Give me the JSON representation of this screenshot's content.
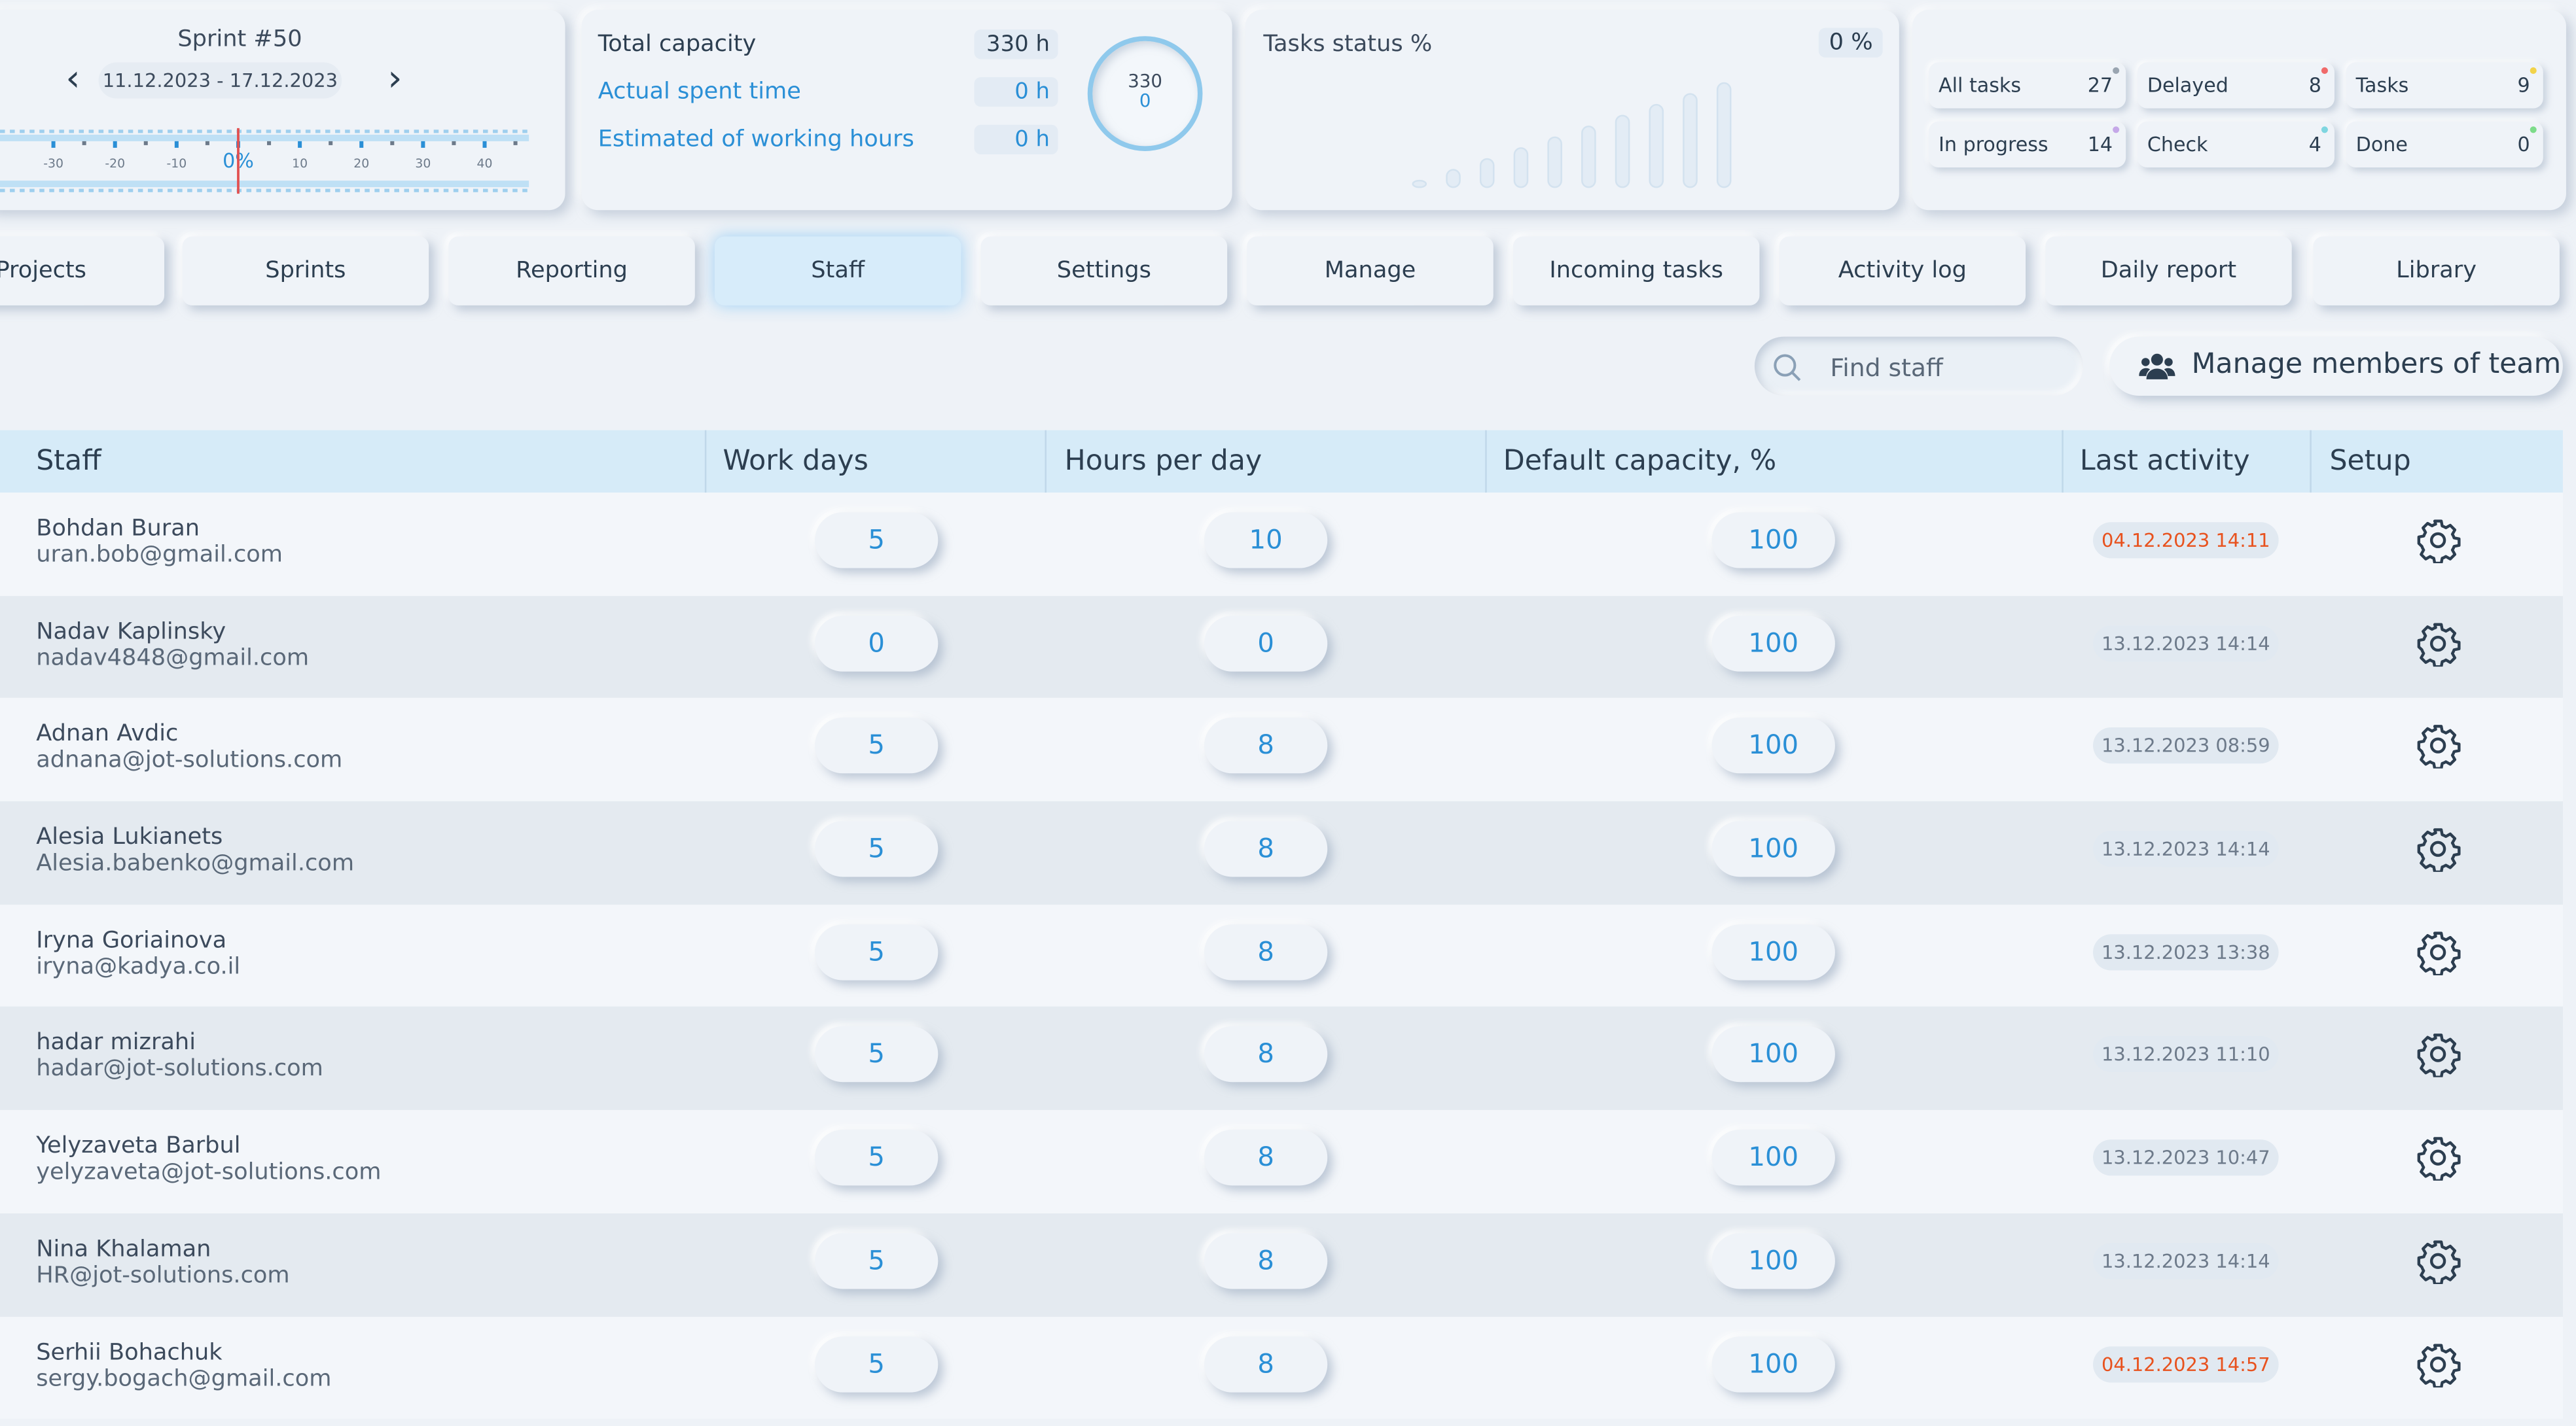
{
  "sprint": {
    "title": "Sprint #50",
    "range": "11.12.2023 - 17.12.2023",
    "scale_ticks": [
      "-30",
      "-20",
      "-10",
      "0%",
      "10",
      "20",
      "30",
      "40"
    ]
  },
  "capacity": {
    "total_label": "Total capacity",
    "total_value": "330 h",
    "actual_label": "Actual spent time",
    "actual_value": "0 h",
    "estimated_label": "Estimated of working hours",
    "estimated_value": "0 h",
    "ring_top": "330",
    "ring_bottom": "0"
  },
  "status": {
    "title": "Tasks status %",
    "value": "0 %"
  },
  "counts": [
    {
      "label": "All tasks",
      "value": "27",
      "dot": "#9aa5b1"
    },
    {
      "label": "Delayed",
      "value": "8",
      "dot": "#f06a6a"
    },
    {
      "label": "Tasks",
      "value": "9",
      "dot": "#f2d34a"
    },
    {
      "label": "In progress",
      "value": "14",
      "dot": "#c5a8e8"
    },
    {
      "label": "Check",
      "value": "4",
      "dot": "#7fd6e0"
    },
    {
      "label": "Done",
      "value": "0",
      "dot": "#7ddc8a"
    }
  ],
  "tabs": [
    "Projects",
    "Sprints",
    "Reporting",
    "Staff",
    "Settings",
    "Manage",
    "Incoming tasks",
    "Activity log",
    "Daily report",
    "Library"
  ],
  "active_tab": "Staff",
  "search": {
    "placeholder": "Find staff"
  },
  "manage_button": "Manage members of team",
  "table": {
    "headers": {
      "staff": "Staff",
      "work_days": "Work days",
      "hours": "Hours per day",
      "capacity": "Default capacity, %",
      "activity": "Last activity",
      "setup": "Setup"
    },
    "rows": [
      {
        "name": "Bohdan Buran",
        "email": "uran.bob@gmail.com",
        "work_days": "5",
        "hours": "10",
        "capacity": "100",
        "activity": "04.12.2023 14:11",
        "stale": true
      },
      {
        "name": "Nadav Kaplinsky",
        "email": "nadav4848@gmail.com",
        "work_days": "0",
        "hours": "0",
        "capacity": "100",
        "activity": "13.12.2023 14:14",
        "stale": false
      },
      {
        "name": "Adnan Avdic",
        "email": "adnana@jot-solutions.com",
        "work_days": "5",
        "hours": "8",
        "capacity": "100",
        "activity": "13.12.2023 08:59",
        "stale": false
      },
      {
        "name": "Alesia Lukianets",
        "email": "Alesia.babenko@gmail.com",
        "work_days": "5",
        "hours": "8",
        "capacity": "100",
        "activity": "13.12.2023 14:14",
        "stale": false
      },
      {
        "name": "Iryna Goriainova",
        "email": "iryna@kadya.co.il",
        "work_days": "5",
        "hours": "8",
        "capacity": "100",
        "activity": "13.12.2023 13:38",
        "stale": false
      },
      {
        "name": "hadar mizrahi",
        "email": "hadar@jot-solutions.com",
        "work_days": "5",
        "hours": "8",
        "capacity": "100",
        "activity": "13.12.2023 11:10",
        "stale": false
      },
      {
        "name": "Yelyzaveta Barbul",
        "email": "yelyzaveta@jot-solutions.com",
        "work_days": "5",
        "hours": "8",
        "capacity": "100",
        "activity": "13.12.2023 10:47",
        "stale": false
      },
      {
        "name": "Nina Khalaman",
        "email": "HR@jot-solutions.com",
        "work_days": "5",
        "hours": "8",
        "capacity": "100",
        "activity": "13.12.2023 14:14",
        "stale": false
      },
      {
        "name": "Serhii Bohachuk",
        "email": "sergy.bogach@gmail.com",
        "work_days": "5",
        "hours": "8",
        "capacity": "100",
        "activity": "04.12.2023 14:57",
        "stale": true
      }
    ]
  }
}
